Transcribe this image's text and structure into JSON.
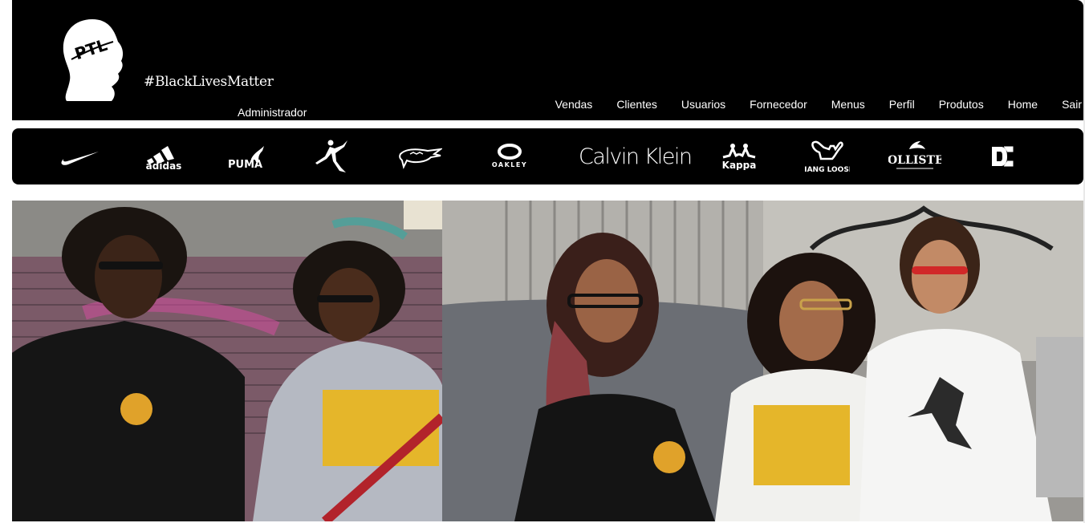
{
  "header": {
    "tagline": "#BlackLivesMatter",
    "user_role": "Administrador",
    "logo_text": "PTL"
  },
  "nav": {
    "items": [
      "Vendas",
      "Clientes",
      "Usuarios",
      "Fornecedor",
      "Menus",
      "Perfil",
      "Produtos",
      "Home",
      "Sair"
    ]
  },
  "brands": {
    "items": [
      "Nike",
      "adidas",
      "PUMA",
      "Jordan",
      "Lacoste",
      "OAKLEY",
      "Calvin Klein",
      "Kappa",
      "HANG LOOSE",
      "HOLLISTER",
      "DC"
    ]
  },
  "colors": {
    "header_bg": "#000000",
    "text": "#ffffff"
  }
}
